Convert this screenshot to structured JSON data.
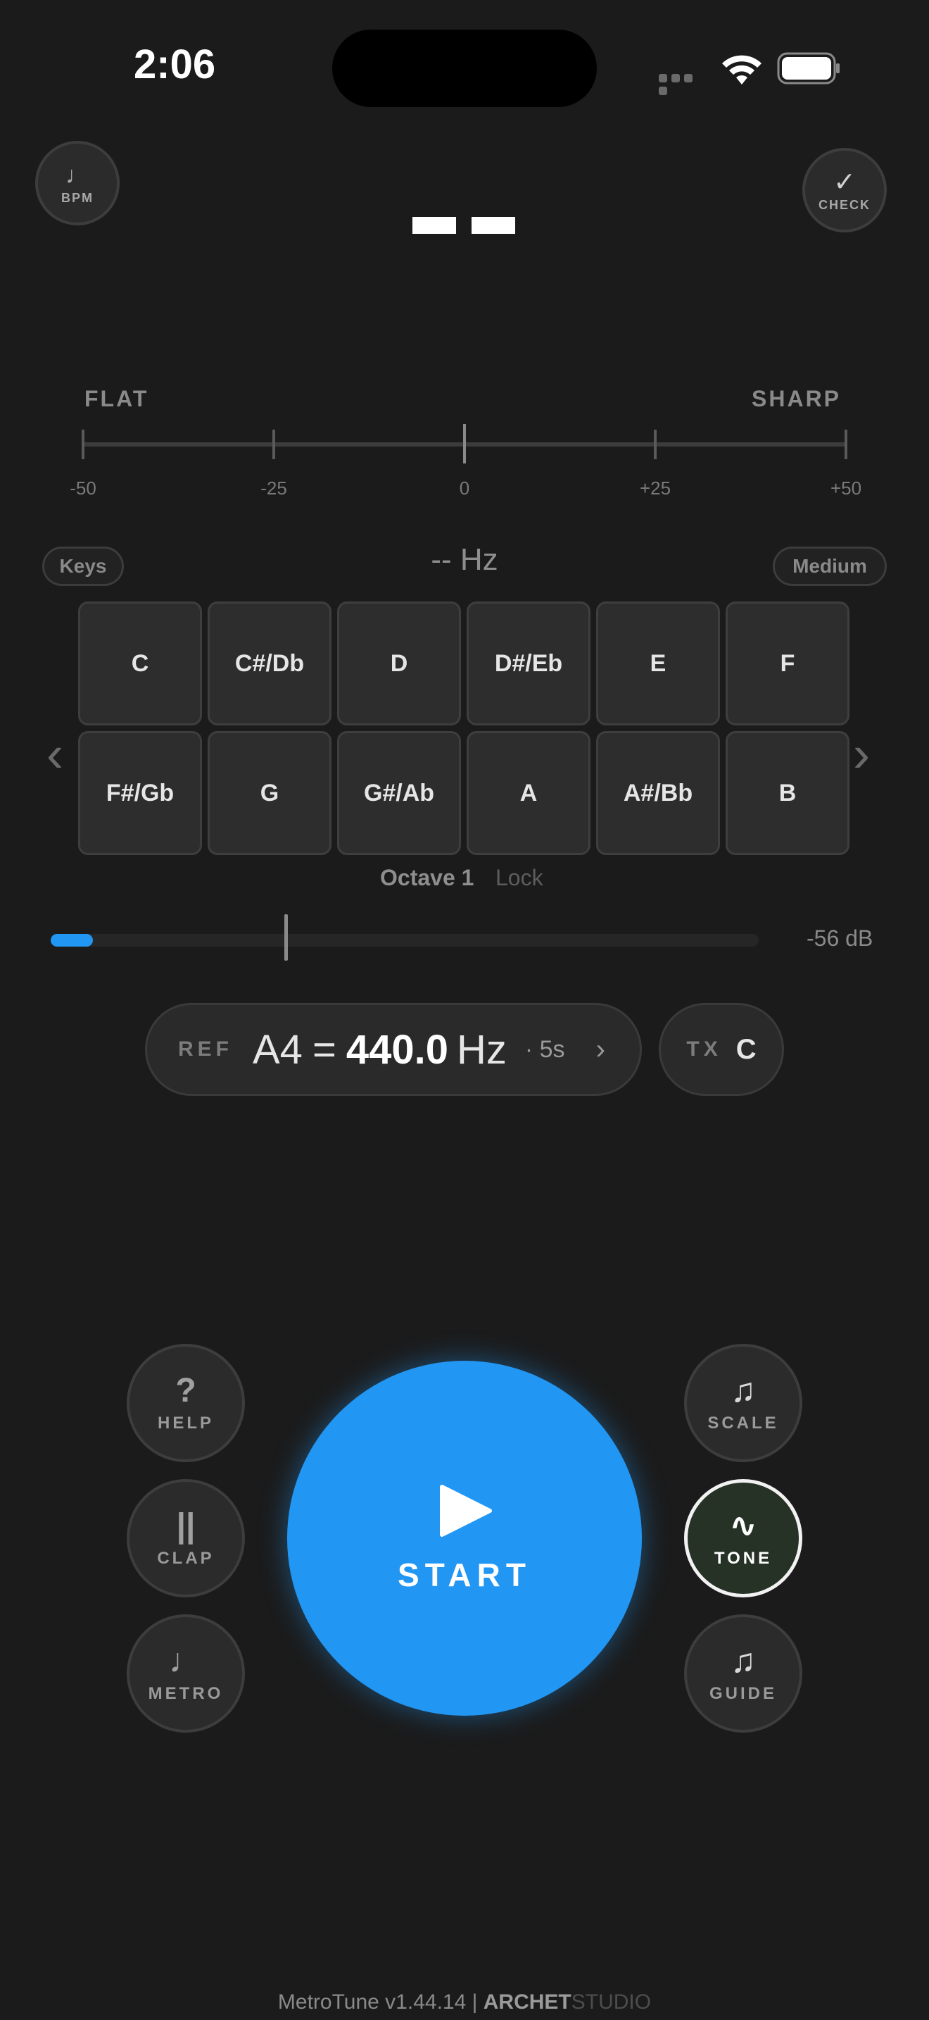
{
  "status": {
    "time": "2:06"
  },
  "top": {
    "bpm_label": "BPM",
    "bpm_icon": "♩",
    "check_label": "CHECK",
    "check_icon": "✓"
  },
  "meter": {
    "flat_label": "FLAT",
    "sharp_label": "SHARP",
    "ticks": [
      "-50",
      "-25",
      "0",
      "+25",
      "+50"
    ]
  },
  "mode": {
    "keys_label": "Keys",
    "hz": "-- Hz",
    "sensitivity_label": "Medium"
  },
  "keys": {
    "row1": [
      "C",
      "C#/Db",
      "D",
      "D#/Eb",
      "E",
      "F"
    ],
    "row2": [
      "F#/Gb",
      "G",
      "G#/Ab",
      "A",
      "A#/Bb",
      "B"
    ],
    "prev": "‹",
    "next": "›"
  },
  "octave": {
    "label": "Octave 1",
    "lock": "Lock"
  },
  "level": {
    "db": "-56 dB",
    "fill_fraction": 0.06,
    "marker_fraction": 0.33
  },
  "reference": {
    "label": "REF",
    "note": "A4",
    "equals": "=",
    "value": "440.0",
    "unit": "Hz",
    "duration": "· 5s",
    "arrow": "›"
  },
  "transpose": {
    "label": "TX",
    "value": "C"
  },
  "controls": {
    "start_label": "START",
    "help_label": "HELP",
    "help_icon": "?",
    "clap_label": "CLAP",
    "clap_icon": "||",
    "metro_label": "METRO",
    "metro_icon": "♩",
    "scale_label": "SCALE",
    "scale_icon": "♫",
    "tone_label": "TONE",
    "tone_icon": "∿",
    "guide_label": "GUIDE",
    "guide_icon": "♫"
  },
  "footer": {
    "app": "MetroTune v1.44.14 |",
    "brand": "ARCHET",
    "studio": "STUDIO"
  },
  "colors": {
    "accent": "#2196f3",
    "background": "#1b1b1b"
  }
}
